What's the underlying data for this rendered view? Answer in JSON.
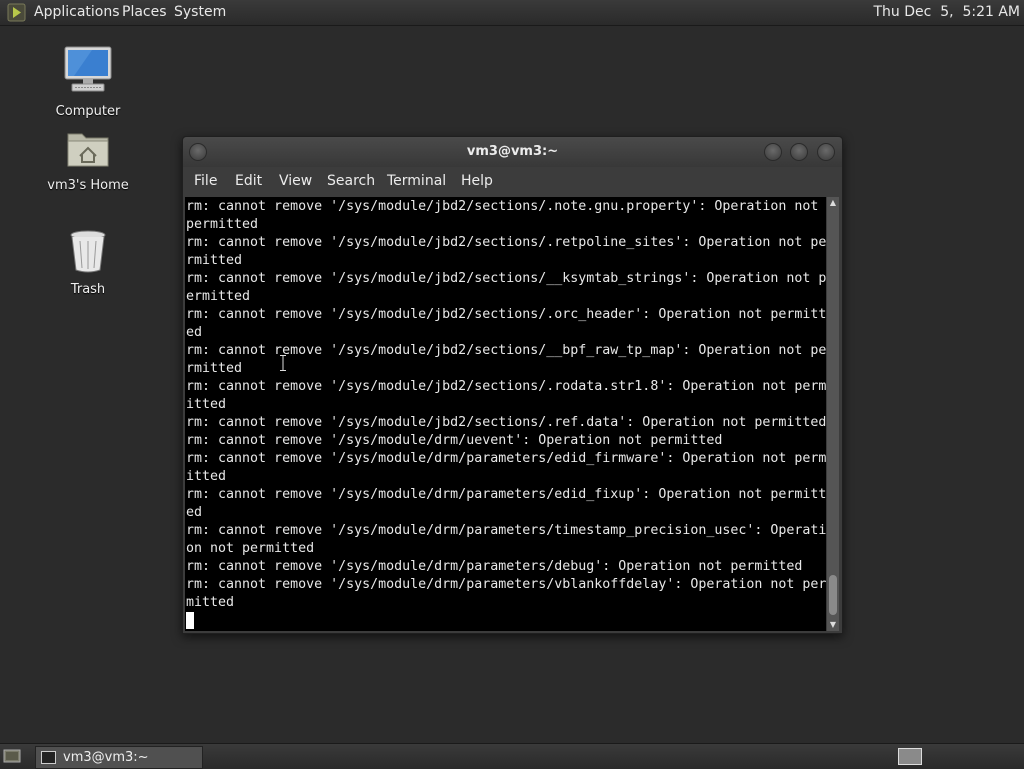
{
  "top_panel": {
    "applications": "Applications",
    "places": "Places",
    "system": "System",
    "clock": "Thu Dec  5,  5:21 AM"
  },
  "desktop": {
    "icons": [
      {
        "label": "Computer",
        "icon": "computer-icon"
      },
      {
        "label": "vm3's Home",
        "icon": "home-folder-icon"
      },
      {
        "label": "Trash",
        "icon": "trash-icon"
      }
    ]
  },
  "terminal": {
    "title": "vm3@vm3:~",
    "menu": [
      "File",
      "Edit",
      "View",
      "Search",
      "Terminal",
      "Help"
    ],
    "lines": [
      "rm: cannot remove '/sys/module/jbd2/sections/.note.gnu.property': Operation not ",
      "permitted",
      "rm: cannot remove '/sys/module/jbd2/sections/.retpoline_sites': Operation not pe",
      "rmitted",
      "rm: cannot remove '/sys/module/jbd2/sections/__ksymtab_strings': Operation not p",
      "ermitted",
      "rm: cannot remove '/sys/module/jbd2/sections/.orc_header': Operation not permitt",
      "ed",
      "rm: cannot remove '/sys/module/jbd2/sections/__bpf_raw_tp_map': Operation not pe",
      "rmitted",
      "rm: cannot remove '/sys/module/jbd2/sections/.rodata.str1.8': Operation not perm",
      "itted",
      "rm: cannot remove '/sys/module/jbd2/sections/.ref.data': Operation not permitted",
      "rm: cannot remove '/sys/module/drm/uevent': Operation not permitted",
      "rm: cannot remove '/sys/module/drm/parameters/edid_firmware': Operation not perm",
      "itted",
      "rm: cannot remove '/sys/module/drm/parameters/edid_fixup': Operation not permitt",
      "ed",
      "rm: cannot remove '/sys/module/drm/parameters/timestamp_precision_usec': Operati",
      "on not permitted",
      "rm: cannot remove '/sys/module/drm/parameters/debug': Operation not permitted",
      "rm: cannot remove '/sys/module/drm/parameters/vblankoffdelay': Operation not per",
      "mitted"
    ]
  },
  "taskbar": {
    "window_label": "vm3@vm3:~"
  },
  "colors": {
    "desktop_bg": "#2b2b2b",
    "terminal_bg": "#000000",
    "terminal_fg": "#e8e8e8"
  }
}
